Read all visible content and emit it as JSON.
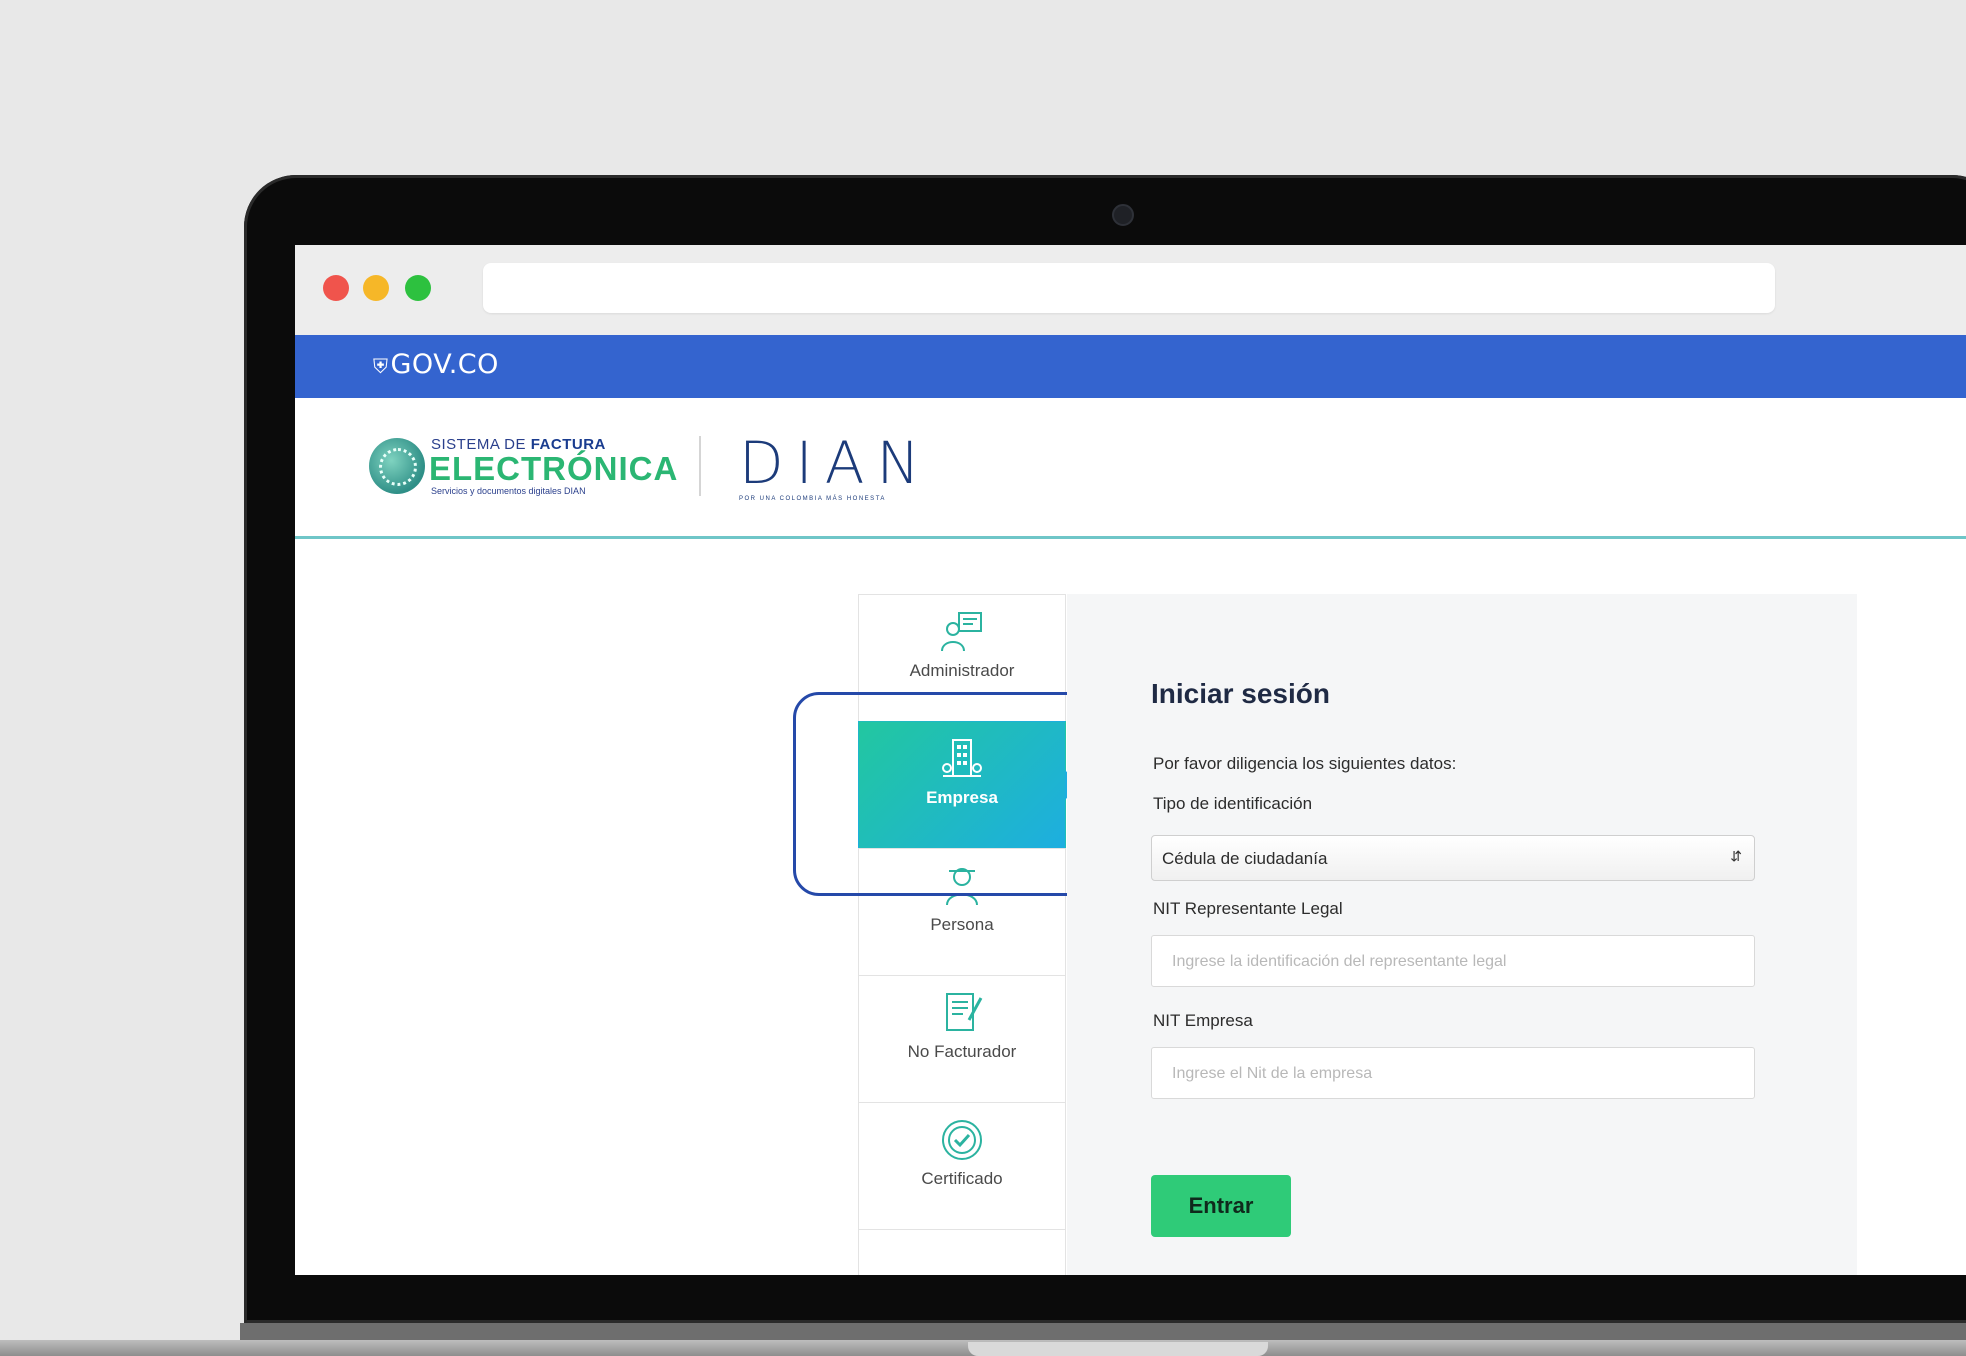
{
  "gov_bar": {
    "logo_text": "GOV.CO"
  },
  "header": {
    "fe_logo": {
      "line1_prefix": "SISTEMA DE ",
      "line1_bold": "FACTURA",
      "line2": "ELECTRÓNICA",
      "line3": "Servicios y documentos digitales DIAN"
    },
    "dian_logo": {
      "word": "DIAN",
      "slogan": "POR UNA COLOMBIA MÁS HONESTA"
    }
  },
  "sidenav": {
    "items": [
      {
        "label": "Administrador",
        "icon": "administrator-icon",
        "active": false
      },
      {
        "label": "Empresa",
        "icon": "building-icon",
        "active": true
      },
      {
        "label": "Persona",
        "icon": "person-icon",
        "active": false
      },
      {
        "label": "No Facturador",
        "icon": "document-pen-icon",
        "active": false
      },
      {
        "label": "Certificado",
        "icon": "certificate-check-icon",
        "active": false
      }
    ]
  },
  "login": {
    "title": "Iniciar sesión",
    "intro": "Por favor diligencia los siguientes datos:",
    "id_type_label": "Tipo de identificación",
    "id_type_value": "Cédula de ciudadanía",
    "nit_rep_label": "NIT Representante Legal",
    "nit_rep_placeholder": "Ingrese la identificación del representante legal",
    "nit_empresa_label": "NIT Empresa",
    "nit_empresa_placeholder": "Ingrese el Nit de la empresa",
    "submit_label": "Entrar"
  },
  "colors": {
    "gov_blue": "#3464cf",
    "accent_green": "#2fcb78",
    "active_tab_start": "#22c7a0",
    "active_tab_end": "#1daee0",
    "highlight": "#2549a9"
  }
}
